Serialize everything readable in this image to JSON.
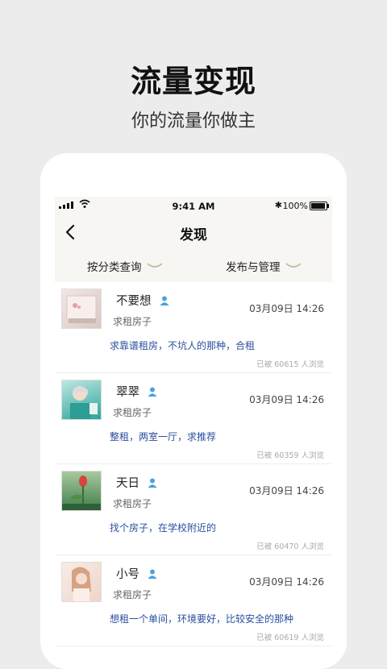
{
  "promo": {
    "title": "流量变现",
    "subtitle": "你的流量你做主"
  },
  "status_bar": {
    "time": "9:41 AM",
    "bluetooth": "✱",
    "battery": "100%"
  },
  "nav": {
    "title": "发现"
  },
  "filters": [
    {
      "label": "按分类查询"
    },
    {
      "label": "发布与管理"
    }
  ],
  "colors": {
    "background": "#ececec",
    "header_bg": "#f7f6f3",
    "content_text": "#2a4f9e",
    "user_icon": "#4aa3df",
    "chevron": "#c8b79a"
  },
  "posts": [
    {
      "name": "不要想",
      "tag": "求租房子",
      "time": "03月09日 14:26",
      "content": "求靠谱租房，不坑人的那种，合租",
      "views": "已被 60615 人浏览"
    },
    {
      "name": "翠翠",
      "tag": "求租房子",
      "time": "03月09日 14:26",
      "content": "整租，两室一厅，求推荐",
      "views": "已被 60359 人浏览"
    },
    {
      "name": "天日",
      "tag": "求租房子",
      "time": "03月09日 14:26",
      "content": "找个房子，在学校附近的",
      "views": "已被 60470 人浏览"
    },
    {
      "name": "小号",
      "tag": "求租房子",
      "time": "03月09日 14:26",
      "content": "想租一个单间，环境要好，比较安全的那种",
      "views": "已被 60619 人浏览"
    }
  ]
}
